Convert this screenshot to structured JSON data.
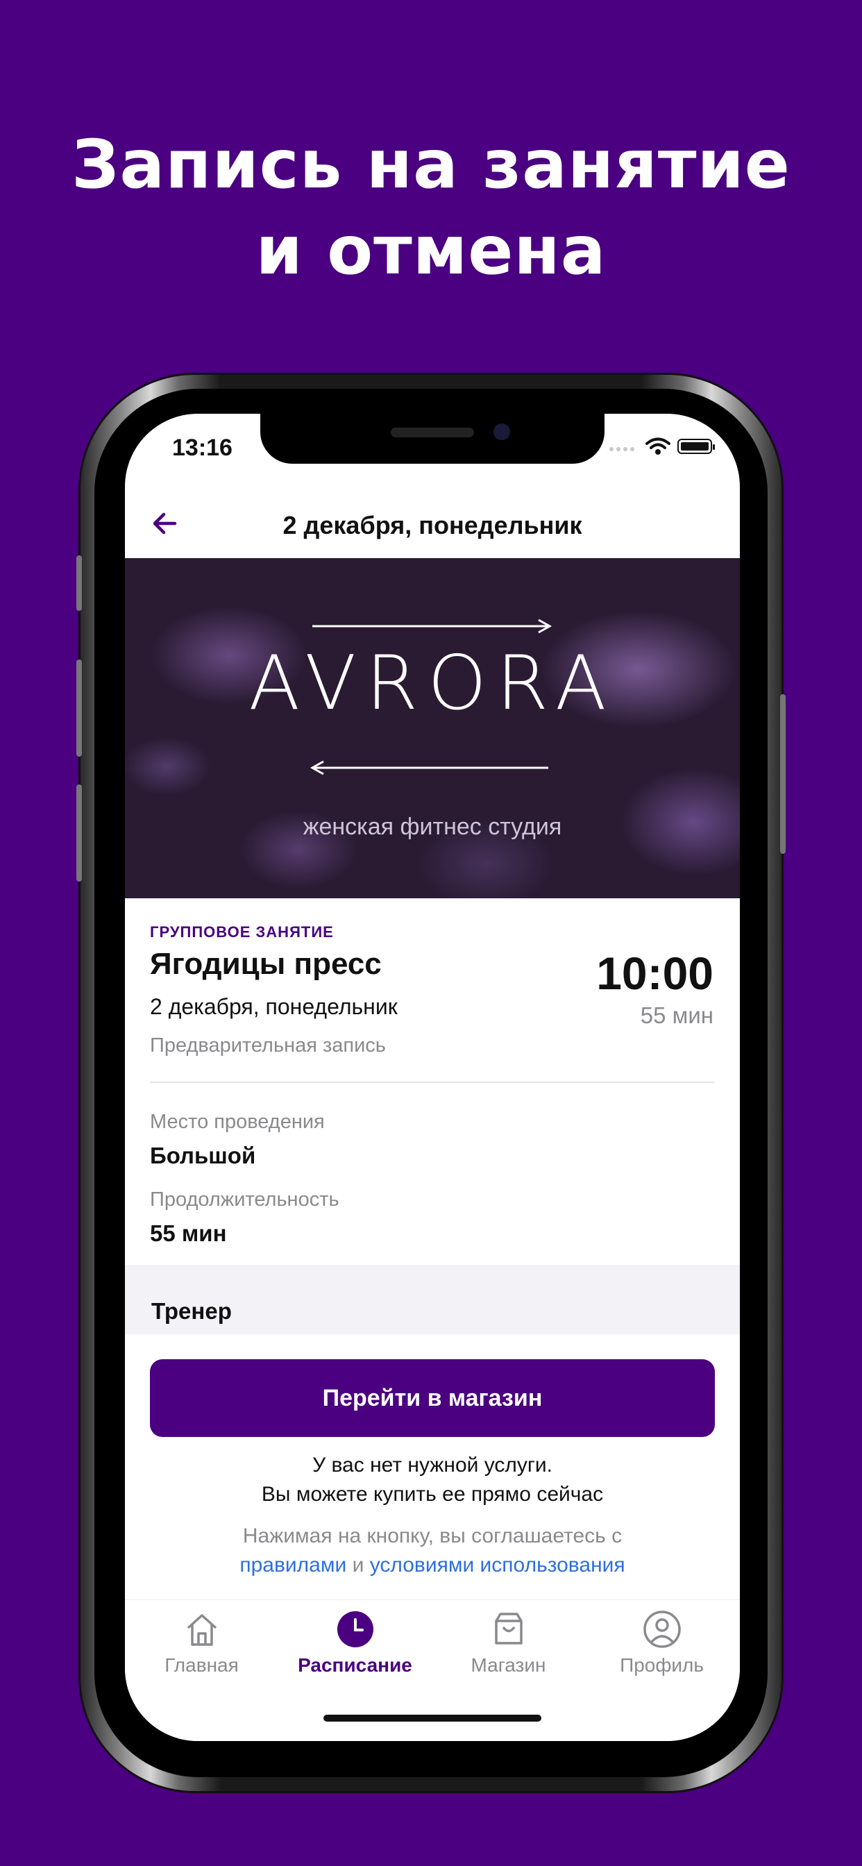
{
  "headline": {
    "line1": "Запись на занятие",
    "line2": "и отмена"
  },
  "status_bar": {
    "time": "13:16"
  },
  "navbar": {
    "title": "2 декабря, понедельник"
  },
  "banner": {
    "brand": "AVRORA",
    "subtitle": "женская фитнес студия"
  },
  "lesson": {
    "kind": "ГРУППОВОЕ ЗАНЯТИЕ",
    "title": "Ягодицы пресс",
    "date": "2 декабря, понедельник",
    "booking": "Предварительная запись",
    "time": "10:00",
    "duration": "55 мин"
  },
  "details": {
    "place_label": "Место проведения",
    "place_value": "Большой",
    "duration_label": "Продолжительность",
    "duration_value": "55 мин"
  },
  "trainer": {
    "label": "Тренер"
  },
  "purchase": {
    "button": "Перейти в магазин",
    "msg_line1": "У вас нет нужной услуги.",
    "msg_line2": "Вы можете купить ее прямо сейчас",
    "agree_text": "Нажимая на кнопку, вы соглашаетесь с",
    "rules_link": "правилами",
    "and": "и",
    "terms_link": "условиями использования"
  },
  "tabs": [
    {
      "label": "Главная",
      "icon": "home-icon"
    },
    {
      "label": "Расписание",
      "icon": "clock-icon",
      "active": true
    },
    {
      "label": "Магазин",
      "icon": "bag-icon"
    },
    {
      "label": "Профиль",
      "icon": "profile-icon"
    }
  ],
  "colors": {
    "brand": "#4a0080",
    "link": "#2f6fde"
  }
}
